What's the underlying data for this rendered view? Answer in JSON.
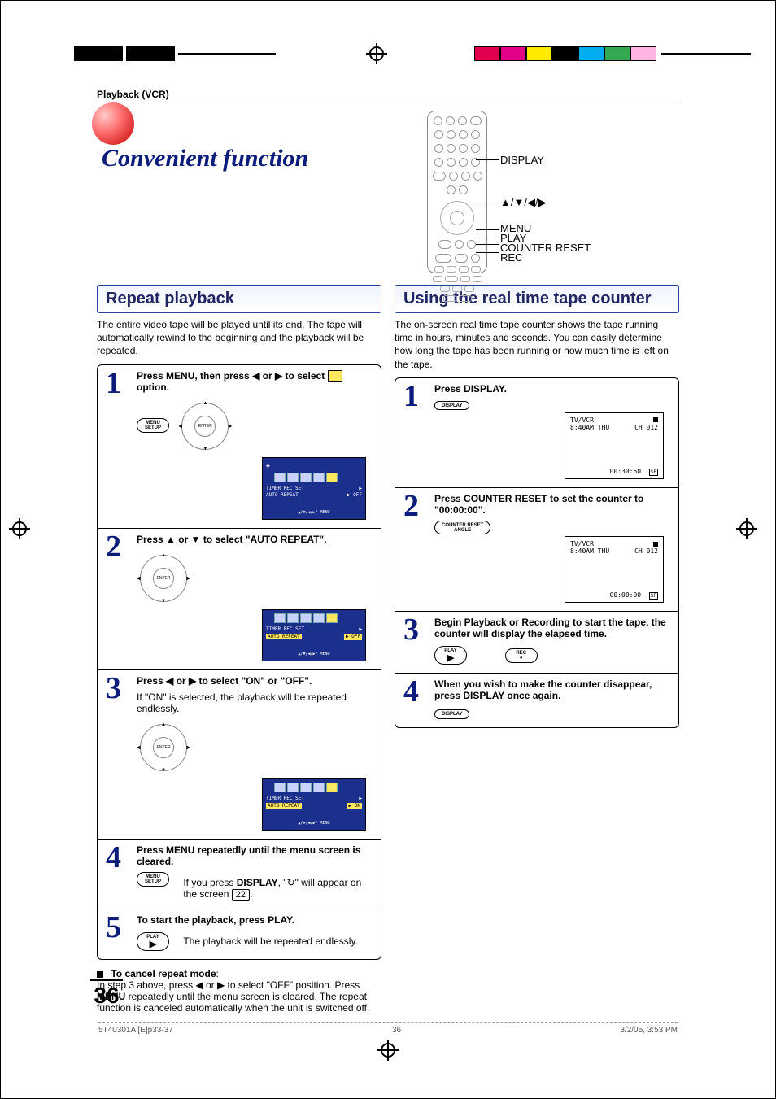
{
  "breadcrumb": "Playback (VCR)",
  "page_title": "Convenient function",
  "remote_labels": {
    "display": "DISPLAY",
    "arrows": "▲/▼/◀/▶",
    "menu": "MENU",
    "play": "PLAY",
    "counter_reset": "COUNTER RESET",
    "rec": "REC"
  },
  "left": {
    "heading": "Repeat playback",
    "intro": "The entire video tape will be played until its end. The tape will automatically rewind to the beginning and the playback will be repeated.",
    "steps": [
      {
        "n": "1",
        "title_parts": [
          "Press MENU, then press ",
          " or ",
          " to select ",
          " option."
        ],
        "l": "◀",
        "r": "▶",
        "btn_label": "MENU\nSETUP",
        "osd": {
          "sel": 5,
          "line1": "TIMER REC SET",
          "line2": "AUTO REPEAT",
          "val1": "▶",
          "val2": "▶ OFF",
          "foot": "▲/▼/◀/▶/ MENU"
        }
      },
      {
        "n": "2",
        "title_parts": [
          "Press ",
          " or ",
          " to select \"AUTO REPEAT\"."
        ],
        "l": "▲",
        "r": "▼",
        "nav_center": "ENTER",
        "osd": {
          "sel": 5,
          "line1": "TIMER REC SET",
          "line2_hl": "AUTO REPEAT",
          "val1": "▶",
          "val2_hl": "▶ OFF",
          "foot": "▲/▼/◀/▶/ MENU"
        }
      },
      {
        "n": "3",
        "title_parts": [
          "Press ",
          " or ",
          " to select \"ON\" or \"OFF\"."
        ],
        "l": "◀",
        "r": "▶",
        "sub": "If \"ON\" is selected, the playback will be repeated endlessly.",
        "nav_center": "ENTER",
        "osd": {
          "sel": 5,
          "line1": "TIMER REC SET",
          "line2_hl": "AUTO REPEAT",
          "val1": "▶",
          "val2_hl": "▶ ON",
          "foot": "▲/▼/◀/▶/ MENU"
        }
      },
      {
        "n": "4",
        "title_a": "Press MENU repeatedly until the menu screen is cleared.",
        "sub_parts": [
          "If you press ",
          "DISPLAY",
          ", \"",
          "↻",
          "\" will appear on the screen "
        ],
        "ref": "22",
        "btn_label": "MENU\nSETUP"
      },
      {
        "n": "5",
        "title_a": "To start the playback, press PLAY.",
        "sub": "The playback will be repeated endlessly.",
        "btn_label": "PLAY",
        "btn_sym": "▶"
      }
    ],
    "cancel_head": "To cancel repeat mode",
    "cancel_body_parts": [
      "In step 3 above, press ",
      " or ",
      " to select \"OFF\" position. Press ",
      "MENU",
      " repeatedly until the menu screen is cleared. The repeat function is canceled automatically when the unit is switched off."
    ],
    "cancel_l": "◀",
    "cancel_r": "▶"
  },
  "right": {
    "heading": "Using the real time tape counter",
    "intro": "The on-screen real time tape counter shows the tape running time in hours, minutes and seconds. You can easily determine how long the tape has been running or how much time is left on the tape.",
    "steps": [
      {
        "n": "1",
        "title_a": "Press DISPLAY.",
        "btn_label": "DISPLAY",
        "tv": {
          "mode": "TV/VCR",
          "clock": "8:40AM THU",
          "ch": "CH 012",
          "counter": "00:30:50",
          "sp": "SP"
        }
      },
      {
        "n": "2",
        "title_a": "Press COUNTER RESET to set the counter to \"00:00:00\".",
        "btn_label": "COUNTER RESET\nANGLE",
        "tv": {
          "mode": "TV/VCR",
          "clock": "8:40AM THU",
          "ch": "CH 012",
          "counter": "00:00:00",
          "sp": "SP"
        }
      },
      {
        "n": "3",
        "title_a": "Begin Playback or Recording to start the tape, the counter will display the elapsed time.",
        "btn_label": "PLAY",
        "btn_sym": "▶",
        "btn2_label": "REC",
        "btn2_sym": "●"
      },
      {
        "n": "4",
        "title_a": "When you wish to make the counter disappear, press DISPLAY once again.",
        "btn_label": "DISPLAY"
      }
    ]
  },
  "page_number": "36",
  "footer": {
    "left": "5T40301A [E]p33-37",
    "center": "36",
    "right": "3/2/05, 3:53 PM"
  }
}
